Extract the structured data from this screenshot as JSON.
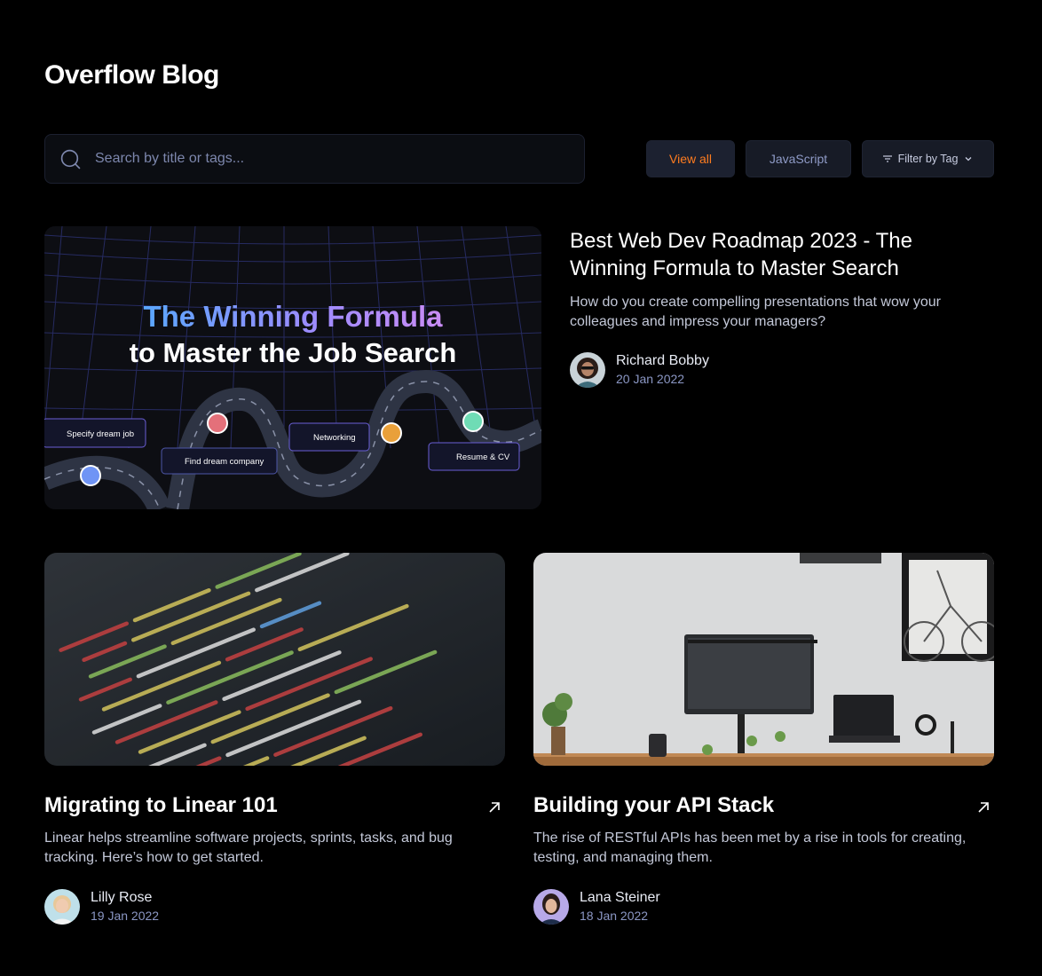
{
  "header": {
    "title": "Overflow Blog"
  },
  "search": {
    "placeholder": "Search by title or tags..."
  },
  "filters": {
    "view_all": "View all",
    "javascript": "JavaScript",
    "filter_by_tag": "Filter by Tag"
  },
  "featured": {
    "image": {
      "headline_1": "The Winning Formula",
      "headline_2": "to Master the Job Search",
      "steps": [
        "Specify dream job",
        "Find dream company",
        "Networking",
        "Resume & CV"
      ]
    },
    "title": "Best Web Dev Roadmap 2023 - The Winning Formula to Master Search",
    "description": "How do you create compelling presentations that wow your colleagues and impress your managers?",
    "author": {
      "name": "Richard Bobby",
      "date": "20 Jan 2022"
    }
  },
  "posts": [
    {
      "title": "Migrating to Linear 101",
      "description": "Linear helps streamline software projects, sprints, tasks, and bug tracking. Here’s how to get started.",
      "author": {
        "name": "Lilly Rose",
        "date": "19 Jan 2022"
      }
    },
    {
      "title": "Building your API Stack",
      "description": "The rise of RESTful APIs has been met by a rise in tools for creating, testing, and managing them.",
      "author": {
        "name": "Lana Steiner",
        "date": "18 Jan 2022"
      }
    }
  ],
  "colors": {
    "accent": "#ff7c1f",
    "background": "#000000",
    "muted": "#8b97c4"
  }
}
